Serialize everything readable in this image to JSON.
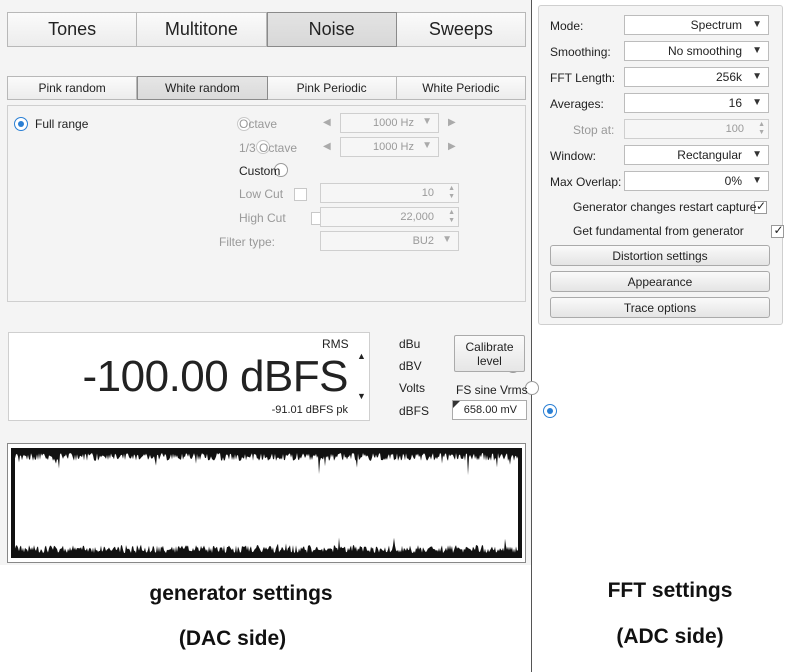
{
  "generator": {
    "tabs": [
      "Tones",
      "Multitone",
      "Noise",
      "Sweeps"
    ],
    "selected_tab": "Noise",
    "subtabs": [
      "Pink random",
      "White random",
      "Pink Periodic",
      "White Periodic"
    ],
    "selected_subtab": "White random",
    "full_range_label": "Full range",
    "octave_label": "Octave",
    "octave_value": "1000 Hz",
    "third_octave_label": "1/3 Octave",
    "third_octave_value": "1000 Hz",
    "custom_label": "Custom",
    "low_cut_label": "Low Cut",
    "low_cut_value": "10",
    "high_cut_label": "High Cut",
    "high_cut_value": "22,000",
    "filter_type_label": "Filter type:",
    "filter_type_value": "BU2",
    "meter": {
      "rms_label": "RMS",
      "value": "-100.00 dBFS",
      "peak": "-91.01 dBFS pk"
    },
    "units": [
      "dBu",
      "dBV",
      "Volts",
      "dBFS"
    ],
    "selected_unit": "dBFS",
    "calibrate_label": "Calibrate level",
    "fs_sine_label": "FS sine Vrms",
    "fs_sine_value": "658.00 mV"
  },
  "fft": {
    "mode_label": "Mode:",
    "mode_value": "Spectrum",
    "smoothing_label": "Smoothing:",
    "smoothing_value": "No smoothing",
    "fft_length_label": "FFT Length:",
    "fft_length_value": "256k",
    "averages_label": "Averages:",
    "averages_value": "16",
    "stop_at_label": "Stop at:",
    "stop_at_value": "100",
    "window_label": "Window:",
    "window_value": "Rectangular",
    "max_overlap_label": "Max Overlap:",
    "max_overlap_value": "0%",
    "gen_restart_label": "Generator changes restart capture",
    "get_fundamental_label": "Get fundamental from generator",
    "distortion_btn": "Distortion settings",
    "appearance_btn": "Appearance",
    "trace_btn": "Trace options"
  },
  "captions": {
    "left_line1": "generator settings",
    "left_line2": "(DAC side)",
    "right_line1": "FFT settings",
    "right_line2": "(ADC side)"
  },
  "colors": {
    "accent": "#2a7fd4",
    "waveform": "#111111"
  }
}
